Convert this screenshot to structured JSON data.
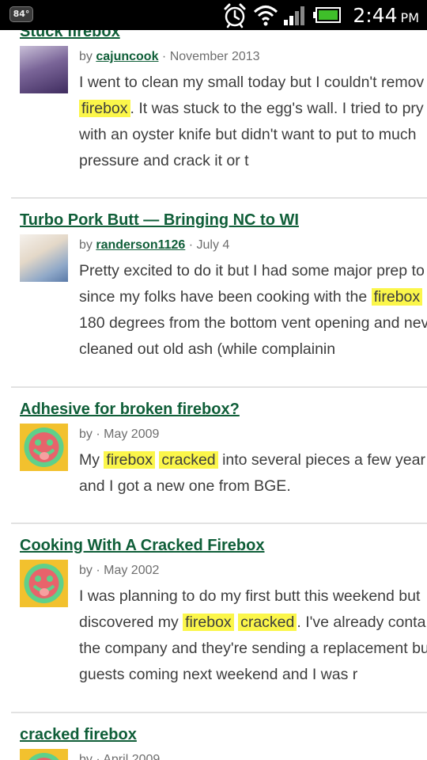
{
  "status_bar": {
    "temperature": "84°",
    "time": "2:44",
    "ampm": "PM"
  },
  "results": [
    {
      "title": "Stuck firebox",
      "by": "by",
      "author": "cajuncook",
      "date": "· November 2013",
      "avatar": "user-photo",
      "lines": [
        [
          {
            "t": "I went to clean my small today but I couldn't remov"
          }
        ],
        [
          {
            "t": "firebox",
            "h": true
          },
          {
            "t": ". It was stuck to the egg's wall. I tried to pry"
          }
        ],
        [
          {
            "t": "with an oyster knife but didn't want to put to much"
          }
        ],
        [
          {
            "t": "pressure and crack it or t"
          }
        ]
      ]
    },
    {
      "title": "Turbo Pork Butt — Bringing NC to WI",
      "by": "by",
      "author": "randerson1126",
      "date": "· July 4",
      "avatar": "user-photo",
      "lines": [
        [
          {
            "t": "Pretty excited to do it but I had some major prep to"
          }
        ],
        [
          {
            "t": "since my folks have been cooking with the "
          },
          {
            "t": "firebox",
            "h": true
          }
        ],
        [
          {
            "t": "180 degrees from the bottom vent opening and nev"
          }
        ],
        [
          {
            "t": "cleaned out old ash (while complainin"
          }
        ]
      ]
    },
    {
      "title": "Adhesive for broken firebox?",
      "by": "by",
      "author": "",
      "date": "· May 2009",
      "avatar": "default-smiley-avatar",
      "lines": [
        [
          {
            "t": "My "
          },
          {
            "t": "firebox",
            "h": true
          },
          {
            "t": " "
          },
          {
            "t": "cracked",
            "h": true
          },
          {
            "t": " into several pieces a few year"
          }
        ],
        [
          {
            "t": "and I got a new one from BGE."
          }
        ]
      ]
    },
    {
      "title": "Cooking With A Cracked Firebox",
      "by": "by",
      "author": "",
      "date": "· May 2002",
      "avatar": "default-smiley-avatar",
      "lines": [
        [
          {
            "t": "I was planning to do my first butt this weekend but"
          }
        ],
        [
          {
            "t": "discovered my "
          },
          {
            "t": "firebox",
            "h": true
          },
          {
            "t": " "
          },
          {
            "t": "cracked",
            "h": true
          },
          {
            "t": ". I've already conta"
          }
        ],
        [
          {
            "t": "the company and they're sending a replacement bu"
          }
        ],
        [
          {
            "t": "guests coming next weekend and I was r"
          }
        ]
      ]
    },
    {
      "title": "cracked firebox",
      "by": "by",
      "author": "",
      "date": "· April 2009",
      "avatar": "default-smiley-avatar",
      "lines": []
    }
  ],
  "colors": {
    "link": "#0f5e38",
    "highlight": "#fbf64a",
    "avatar_bg": "#f2c12e",
    "avatar_face": "#e8636b",
    "avatar_ring": "#5fd08a"
  }
}
